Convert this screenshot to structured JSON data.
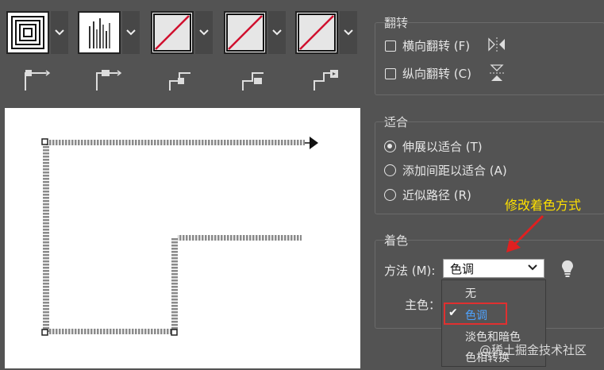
{
  "flip": {
    "title": "翻转",
    "horizontal_label": "横向翻转 (F)",
    "vertical_label": "纵向翻转 (C)"
  },
  "fit": {
    "title": "适合",
    "options": [
      "伸展以适合 (T)",
      "添加间距以适合 (A)",
      "近似路径 (R)"
    ],
    "selected_index": 0
  },
  "colorize": {
    "title": "着色",
    "method_label": "方法 (M):",
    "method_value": "色调",
    "key_color_label": "主色：",
    "options": [
      "无",
      "色调",
      "淡色和暗色",
      "色相转换"
    ],
    "selected_option": "色调"
  },
  "annotation": "修改着色方式",
  "watermark": "@稀土掘金技术社区",
  "colors": {
    "panel_bg": "#535353",
    "accent_selected": "#4ea3ff",
    "highlight_red": "#e03030",
    "annotation_yellow": "#ffe100",
    "tile_slash": "#d0102e"
  },
  "tiles": [
    {
      "name": "outer-corner-tile",
      "icon": "nested-squares-icon"
    },
    {
      "name": "side-tile",
      "icon": "vertical-lines-icon"
    },
    {
      "name": "inner-corner-tile",
      "icon": "none-slash-icon"
    },
    {
      "name": "start-tile",
      "icon": "none-slash-icon"
    },
    {
      "name": "end-tile",
      "icon": "none-slash-icon"
    }
  ]
}
